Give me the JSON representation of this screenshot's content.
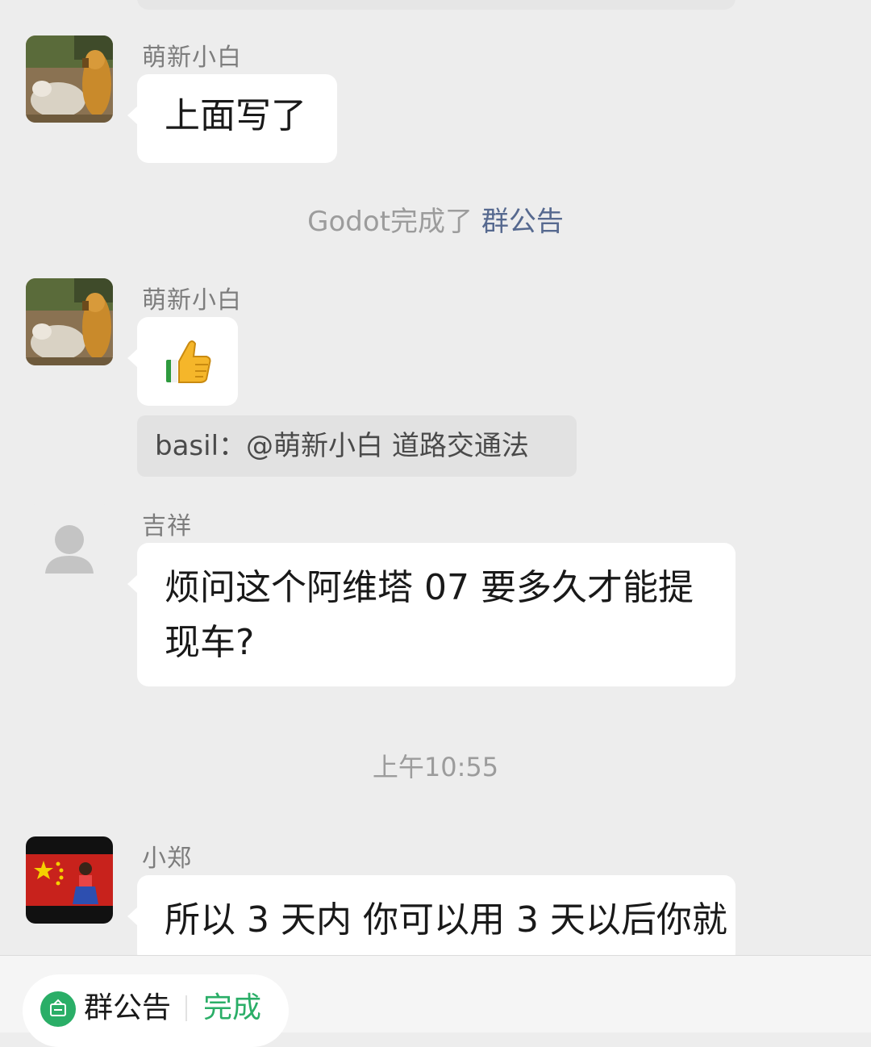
{
  "messages": [
    {
      "sender": "萌新小白",
      "text": "上面写了"
    },
    {
      "sender": "萌新小白",
      "emoji": "👍"
    },
    {
      "sender": "吉祥",
      "text": "烦问这个阿维塔 07 要多久才能提现车?"
    },
    {
      "sender": "小郑",
      "text": "所以 3 天内 你可以用 3 天以后你就"
    }
  ],
  "system_notice": {
    "prefix": "Godot完成了",
    "link": "群公告"
  },
  "quote": {
    "text": "basil：@萌新小白 道路交通法"
  },
  "timestamp": "上午10:55",
  "bottom_bar": {
    "label": "群公告",
    "done": "完成"
  },
  "colors": {
    "link": "#56698f",
    "accent_green": "#2aae67",
    "background": "#ededed"
  },
  "icons": {
    "notice": "announcement-icon",
    "default_avatar": "person-placeholder-icon"
  }
}
